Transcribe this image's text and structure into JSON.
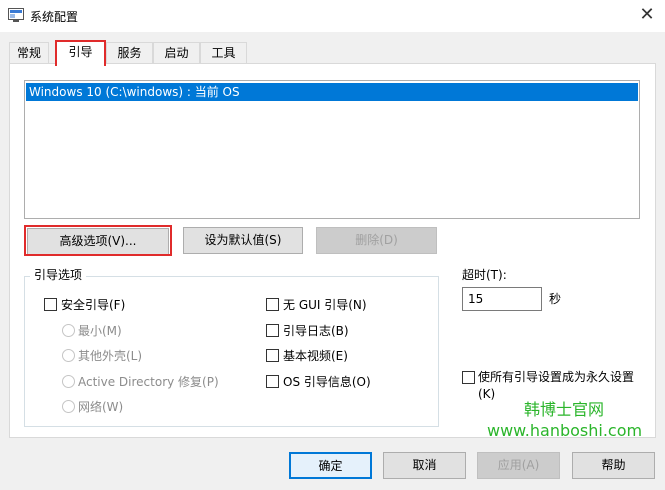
{
  "window": {
    "title": "系统配置",
    "close_glyph": "✕"
  },
  "tabs": [
    {
      "label": "常规"
    },
    {
      "label": "引导"
    },
    {
      "label": "服务"
    },
    {
      "label": "启动"
    },
    {
      "label": "工具"
    }
  ],
  "selected_tab": "引导",
  "os_list": {
    "items": [
      "Windows 10 (C:\\windows) : 当前 OS"
    ]
  },
  "list_buttons": {
    "advanced": "高级选项(V)...",
    "set_default": "设为默认值(S)",
    "delete": "删除(D)"
  },
  "boot_options": {
    "title": "引导选项",
    "safe_boot": "安全引导(F)",
    "minimal": "最小(M)",
    "alternate_shell": "其他外壳(L)",
    "active_directory": "Active Directory 修复(P)",
    "network": "网络(W)",
    "no_gui": "无 GUI 引导(N)",
    "boot_log": "引导日志(B)",
    "base_video": "基本视频(E)",
    "os_boot_info": "OS 引导信息(O)"
  },
  "timeout": {
    "label": "超时(T):",
    "value": "15",
    "unit": "秒"
  },
  "permanent": {
    "line1": "使所有引导设置成为永久设置",
    "line2": "(K)"
  },
  "watermark": {
    "cn": "韩博士官网",
    "url": "www.hanboshi.com"
  },
  "footer": {
    "ok": "确定",
    "cancel": "取消",
    "apply": "应用(A)",
    "help": "帮助"
  },
  "colors": {
    "selection": "#0078d7",
    "highlight_box": "#e02b2b",
    "watermark": "#2bb52b"
  }
}
